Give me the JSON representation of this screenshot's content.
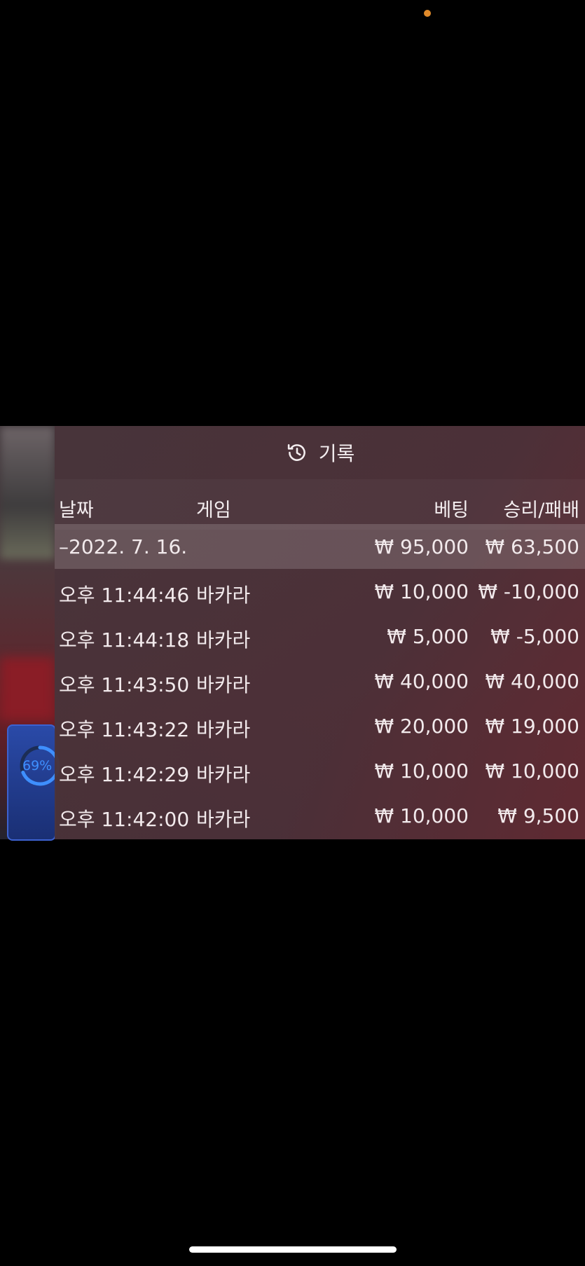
{
  "panel": {
    "title": "기록",
    "columns": {
      "date": "날짜",
      "game": "게임",
      "bet": "베팅",
      "result": "승리/패배"
    }
  },
  "summary": {
    "date": "–2022. 7. 16.",
    "bet": "₩ 95,000",
    "result": "₩ 63,500"
  },
  "records": [
    {
      "time": "오후 11:44:46",
      "game": "바카라",
      "bet": "₩ 10,000",
      "result": "₩ -10,000"
    },
    {
      "time": "오후 11:44:18",
      "game": "바카라",
      "bet": "₩ 5,000",
      "result": "₩ -5,000"
    },
    {
      "time": "오후 11:43:50",
      "game": "바카라",
      "bet": "₩ 40,000",
      "result": "₩ 40,000"
    },
    {
      "time": "오후 11:43:22",
      "game": "바카라",
      "bet": "₩ 20,000",
      "result": "₩ 19,000"
    },
    {
      "time": "오후 11:42:29",
      "game": "바카라",
      "bet": "₩ 10,000",
      "result": "₩ 10,000"
    },
    {
      "time": "오후 11:42:00",
      "game": "바카라",
      "bet": "₩ 10,000",
      "result": "₩ 9,500"
    }
  ],
  "progress_badge": {
    "text": "69%",
    "value": 0.69
  },
  "colors": {
    "accent": "#3e8fff",
    "status_dot": "#e08a2a"
  },
  "icons": {
    "header": "history-icon"
  }
}
